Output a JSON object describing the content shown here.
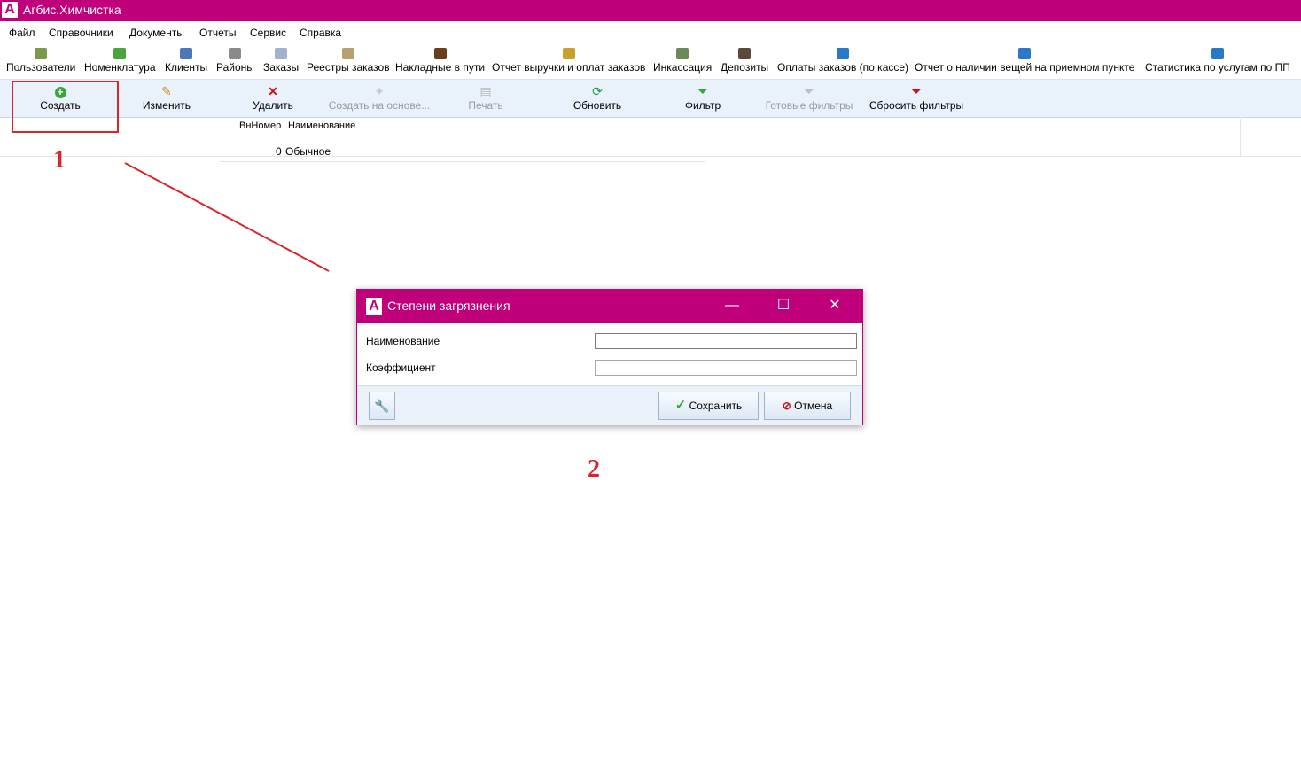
{
  "app": {
    "title": "Агбис.Химчистка",
    "logo_letter": "A"
  },
  "menu": [
    "Файл",
    "Справочники",
    "Документы",
    "Отчеты",
    "Сервис",
    "Справка"
  ],
  "nav_items": [
    {
      "label": "Пользователи",
      "icon": "users-icon"
    },
    {
      "label": "Номенклатура",
      "icon": "checklist-icon"
    },
    {
      "label": "Клиенты",
      "icon": "client-icon"
    },
    {
      "label": "Районы",
      "icon": "buildings-icon"
    },
    {
      "label": "Заказы",
      "icon": "document-icon"
    },
    {
      "label": "Реестры заказов",
      "icon": "clipboard-icon"
    },
    {
      "label": "Накладные в пути",
      "icon": "truck-icon"
    },
    {
      "label": "Отчет выручки и оплат заказов",
      "icon": "money-stack-icon"
    },
    {
      "label": "Инкассация",
      "icon": "cash-icon"
    },
    {
      "label": "Депозиты",
      "icon": "money-bag-icon"
    },
    {
      "label": "Оплаты заказов (по кассе)",
      "icon": "report-icon"
    },
    {
      "label": "Отчет о наличии вещей на приемном пункте",
      "icon": "report-icon"
    },
    {
      "label": "Статистика по услугам по ПП",
      "icon": "report-icon"
    }
  ],
  "toolbar": {
    "create": "Создать",
    "edit": "Изменить",
    "delete": "Удалить",
    "create_based": "Создать на основе...",
    "print": "Печать",
    "refresh": "Обновить",
    "filter": "Фильтр",
    "ready_filters": "Готовые фильтры",
    "reset_filters": "Сбросить фильтры"
  },
  "grid": {
    "columns": [
      "ВнНомер",
      "Наименование"
    ],
    "rows": [
      {
        "id": "0",
        "name": "Обычное"
      }
    ]
  },
  "annotations": {
    "one": "1",
    "two": "2"
  },
  "dialog": {
    "title": "Степени загрязнения",
    "fields": [
      {
        "label": "Наименование",
        "value": ""
      },
      {
        "label": "Коэффициент",
        "value": ""
      }
    ],
    "save": "Сохранить",
    "cancel": "Отмена"
  },
  "colors": {
    "accent": "#c0007a",
    "annotation": "#d9262b",
    "toolbar_bg": "#e9f2fb"
  }
}
